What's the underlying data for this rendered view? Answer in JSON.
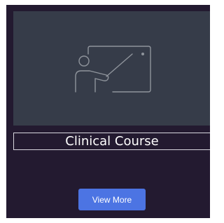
{
  "card": {
    "title": "Clinical Course",
    "thumbnail_icon": "teacher-whiteboard-icon",
    "button_label": "View More"
  },
  "colors": {
    "card_background": "#231a30",
    "thumbnail_background": "#363c49",
    "icon_stroke": "#8f949c",
    "button_background": "#4c74e3",
    "text": "#ffffff"
  }
}
